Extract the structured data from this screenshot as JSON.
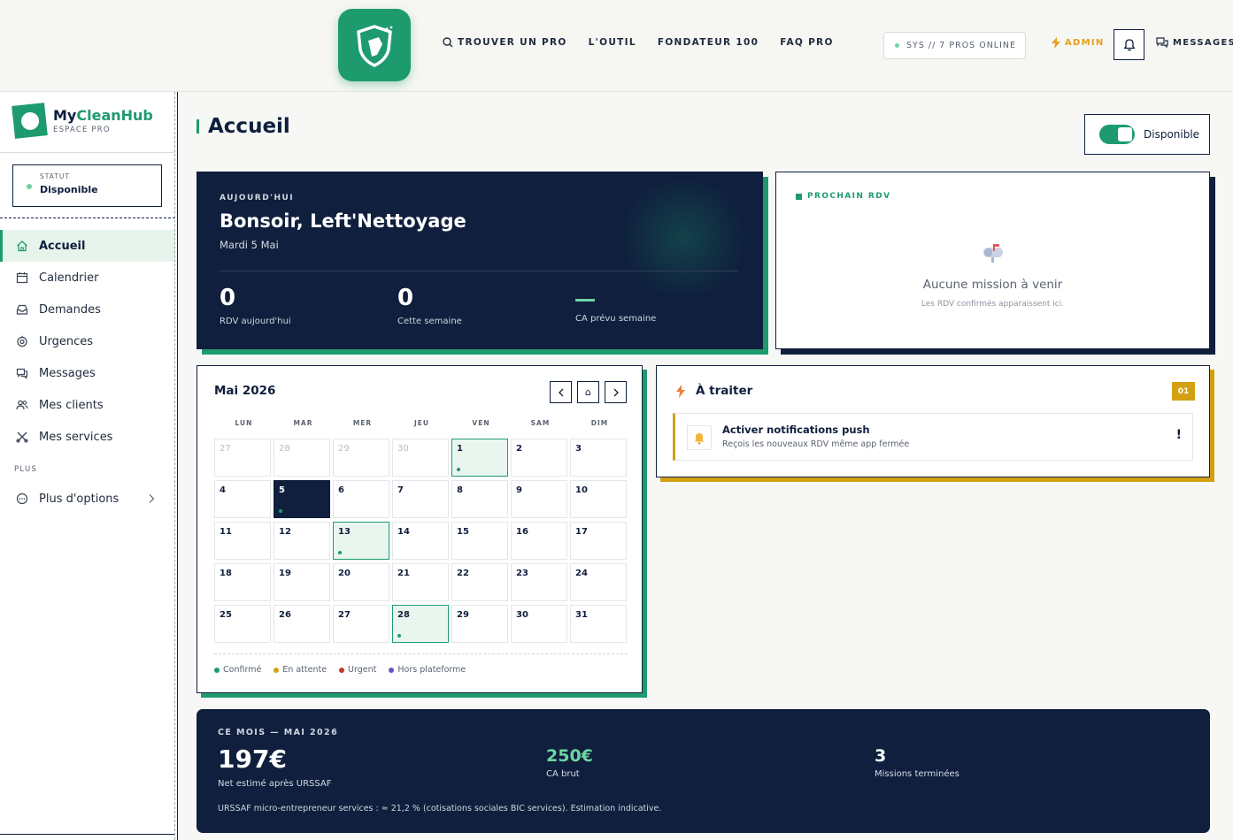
{
  "topnav": {
    "links": [
      "TROUVER UN PRO",
      "L'OUTIL",
      "FONDATEUR 100",
      "FAQ PRO"
    ],
    "system_status": "SYS // 7 PROS ONLINE",
    "admin_label": "ADMIN",
    "messages_label": "MESSAGES"
  },
  "sidebar": {
    "brand_prefix": "My",
    "brand_suffix": "CleanHub",
    "brand_sub": "ESPACE PRO",
    "status_label": "STATUT",
    "status_value": "Disponible",
    "items": [
      {
        "label": "Accueil",
        "icon": "home-icon"
      },
      {
        "label": "Calendrier",
        "icon": "calendar-icon"
      },
      {
        "label": "Demandes",
        "icon": "inbox-icon"
      },
      {
        "label": "Urgences",
        "icon": "alert-icon"
      },
      {
        "label": "Messages",
        "icon": "chat-icon"
      },
      {
        "label": "Mes clients",
        "icon": "users-icon"
      },
      {
        "label": "Mes services",
        "icon": "tools-icon"
      }
    ],
    "section_more": "PLUS",
    "more_options": "Plus d'options"
  },
  "header": {
    "title": "Accueil",
    "availability_label": "Disponible"
  },
  "hero": {
    "kicker": "AUJOURD'HUI",
    "greeting": "Bonsoir, Left'Nettoyage",
    "date": "Mardi 5 Mai",
    "stats": [
      {
        "value": "0",
        "label": "RDV aujourd'hui"
      },
      {
        "value": "0",
        "label": "Cette semaine"
      },
      {
        "value": "",
        "label": "CA prévu semaine"
      }
    ]
  },
  "next_appointment": {
    "kicker": "PROCHAIN RDV",
    "empty_title": "Aucune mission à venir",
    "empty_sub": "Les RDV confirmés apparaissent ici."
  },
  "calendar": {
    "month_label": "Mai 2026",
    "home_glyph": "⌂",
    "weekdays": [
      "LUN",
      "MAR",
      "MER",
      "JEU",
      "VEN",
      "SAM",
      "DIM"
    ],
    "days": [
      {
        "n": "27",
        "other": true
      },
      {
        "n": "28",
        "other": true
      },
      {
        "n": "29",
        "other": true
      },
      {
        "n": "30",
        "other": true
      },
      {
        "n": "1",
        "event": true
      },
      {
        "n": "2"
      },
      {
        "n": "3"
      },
      {
        "n": "4"
      },
      {
        "n": "5",
        "today": true
      },
      {
        "n": "6"
      },
      {
        "n": "7"
      },
      {
        "n": "8"
      },
      {
        "n": "9"
      },
      {
        "n": "10"
      },
      {
        "n": "11"
      },
      {
        "n": "12"
      },
      {
        "n": "13",
        "event": true
      },
      {
        "n": "14"
      },
      {
        "n": "15"
      },
      {
        "n": "16"
      },
      {
        "n": "17"
      },
      {
        "n": "18"
      },
      {
        "n": "19"
      },
      {
        "n": "20"
      },
      {
        "n": "21"
      },
      {
        "n": "22"
      },
      {
        "n": "23"
      },
      {
        "n": "24"
      },
      {
        "n": "25"
      },
      {
        "n": "26"
      },
      {
        "n": "27"
      },
      {
        "n": "28",
        "event": true
      },
      {
        "n": "29"
      },
      {
        "n": "30"
      },
      {
        "n": "31"
      }
    ],
    "legend": [
      {
        "label": "Confirmé",
        "color": "#1e9b6e"
      },
      {
        "label": "En attente",
        "color": "#d3a012"
      },
      {
        "label": "Urgent",
        "color": "#c0392b"
      },
      {
        "label": "Hors plateforme",
        "color": "#6c4fc2"
      }
    ]
  },
  "todo": {
    "title": "À traiter",
    "count": "01",
    "item_title": "Activer notifications push",
    "item_sub": "Reçois les nouveaux RDV même app fermée",
    "item_flag": "!"
  },
  "month_summary": {
    "kicker": "CE MOIS — MAI 2026",
    "net_value": "197€",
    "net_label": "Net estimé après URSSAF",
    "gross_value": "250€",
    "gross_label": "CA brut",
    "missions_value": "3",
    "missions_label": "Missions terminées",
    "note": "URSSAF micro-entrepreneur services : ≈ 21,2 % (cotisations sociales BIC services). Estimation indicative."
  },
  "colors": {
    "brand_green": "#1e9b6e",
    "navy": "#0f1f3d",
    "mint": "#6fd4a4",
    "amber": "#d3a012",
    "admin_orange": "#e5a01c"
  }
}
